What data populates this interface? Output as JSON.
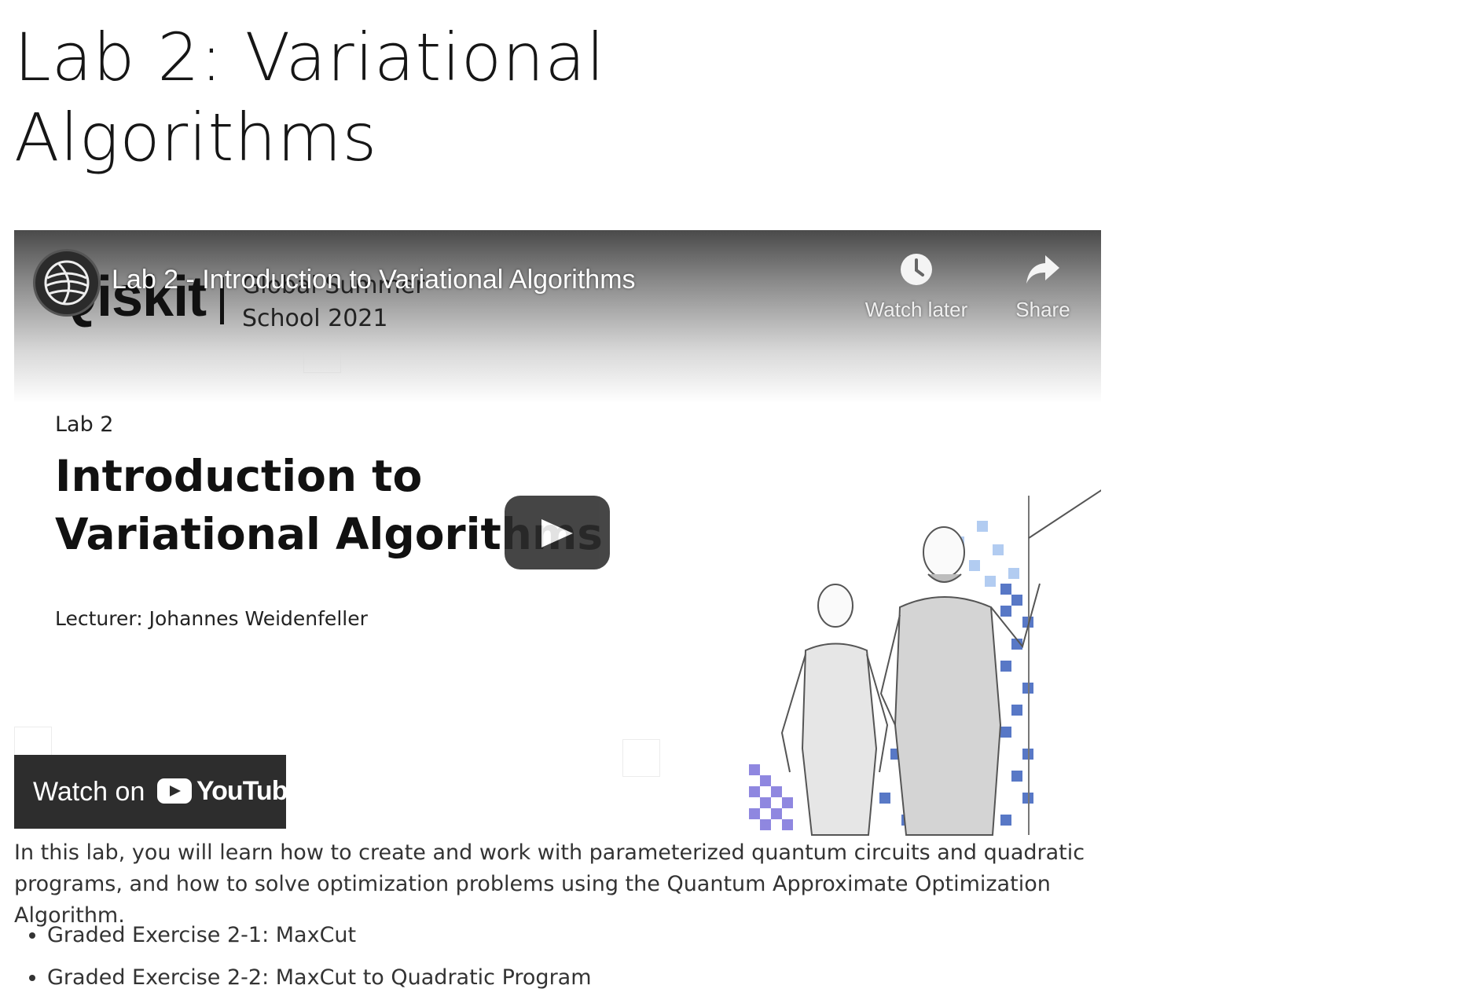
{
  "page": {
    "title": "Lab 2: Variational Algorithms",
    "intro": "In this lab, you will learn how to create and work with parameterized quantum circuits and quadratic programs, and how to solve optimization problems using the Quantum Approximate Optimization Algorithm.",
    "exercises": [
      "Graded Exercise 2-1: MaxCut",
      "Graded Exercise 2-2: MaxCut to Quadratic Program"
    ]
  },
  "video": {
    "title": "Lab 2 - Introduction to Variational Algorithms",
    "brand": "Qiskit",
    "brand_subtitle": "Global Summer\nSchool 2021",
    "watch_later_label": "Watch later",
    "share_label": "Share",
    "slide_kicker": "Lab 2",
    "slide_title": "Introduction to\nVariational Algorithms",
    "slide_lecturer": "Lecturer: Johannes Weidenfeller",
    "watch_on_label": "Watch on",
    "youtube_wordmark": "YouTube",
    "icons": [
      "qiskit-logo-icon",
      "clock-icon",
      "share-arrow-icon",
      "play-icon",
      "youtube-logo-icon"
    ]
  }
}
